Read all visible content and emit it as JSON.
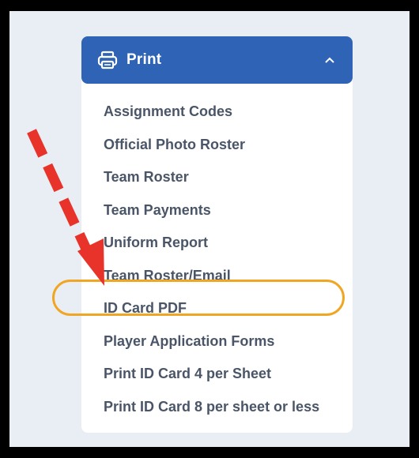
{
  "panel": {
    "title": "Print",
    "icon": "printer-icon",
    "toggle_icon": "chevron-up-icon",
    "accent_color": "#2f63b6"
  },
  "menu": {
    "items": [
      {
        "label": "Assignment Codes"
      },
      {
        "label": "Official Photo Roster"
      },
      {
        "label": "Team Roster"
      },
      {
        "label": "Team Payments"
      },
      {
        "label": "Uniform Report"
      },
      {
        "label": "Team Roster/Email"
      },
      {
        "label": "ID Card PDF",
        "highlighted": true
      },
      {
        "label": "Player Application Forms"
      },
      {
        "label": "Print ID Card 4 per Sheet"
      },
      {
        "label": "Print ID Card 8 per sheet or less"
      }
    ]
  },
  "annotation": {
    "arrow_color": "#e8332a",
    "highlight_color": "#f0a623"
  }
}
